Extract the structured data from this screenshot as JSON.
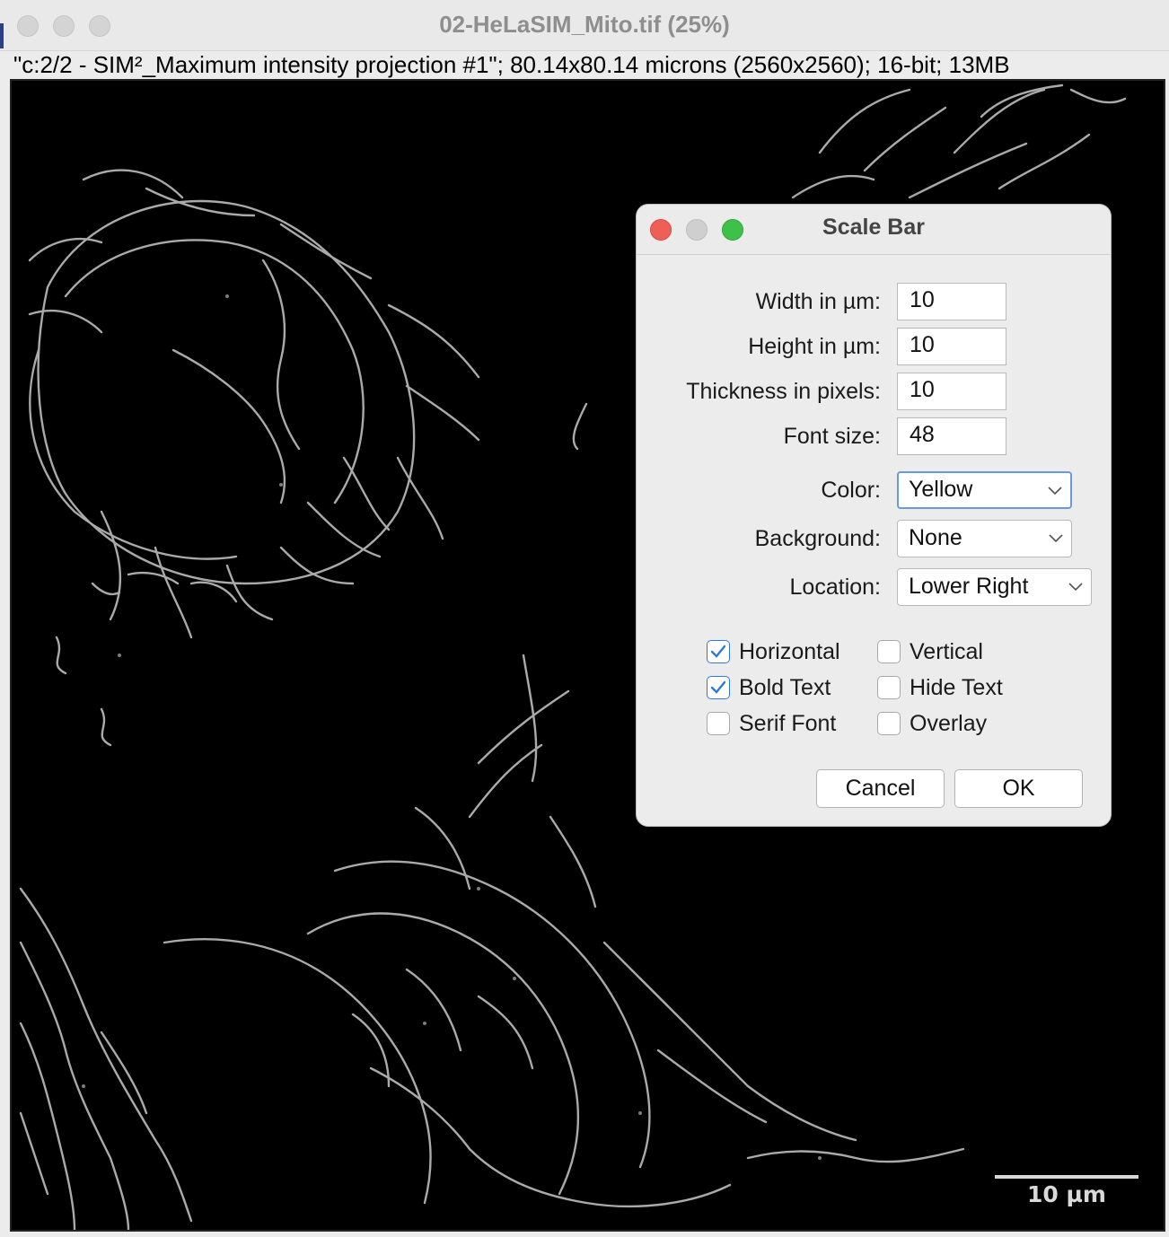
{
  "window": {
    "title": "02-HeLaSIM_Mito.tif (25%)",
    "info_line": "\"c:2/2 - SIM²_Maximum intensity projection #1\"; 80.14x80.14 microns (2560x2560); 16-bit; 13MB"
  },
  "image": {
    "scale_bar_text": "10 µm",
    "scale_bar_color": "#d9d9d9"
  },
  "dialog": {
    "title": "Scale Bar",
    "fields": {
      "width_label": "Width in µm:",
      "width_value": "10",
      "height_label": "Height in µm:",
      "height_value": "10",
      "thickness_label": "Thickness in pixels:",
      "thickness_value": "10",
      "font_size_label": "Font size:",
      "font_size_value": "48"
    },
    "selects": {
      "color_label": "Color:",
      "color_value": "Yellow",
      "background_label": "Background:",
      "background_value": "None",
      "location_label": "Location:",
      "location_value": "Lower Right"
    },
    "checkboxes": {
      "horizontal": {
        "label": "Horizontal",
        "checked": true
      },
      "vertical": {
        "label": "Vertical",
        "checked": false
      },
      "bold_text": {
        "label": "Bold Text",
        "checked": true
      },
      "hide_text": {
        "label": "Hide Text",
        "checked": false
      },
      "serif_font": {
        "label": "Serif Font",
        "checked": false
      },
      "overlay": {
        "label": "Overlay",
        "checked": false
      }
    },
    "buttons": {
      "cancel": "Cancel",
      "ok": "OK"
    }
  },
  "colors": {
    "close": "#ee5f57",
    "minimize": "#cfcfcf",
    "zoom": "#3ec148",
    "checkbox_accent": "#2f7ad8"
  }
}
